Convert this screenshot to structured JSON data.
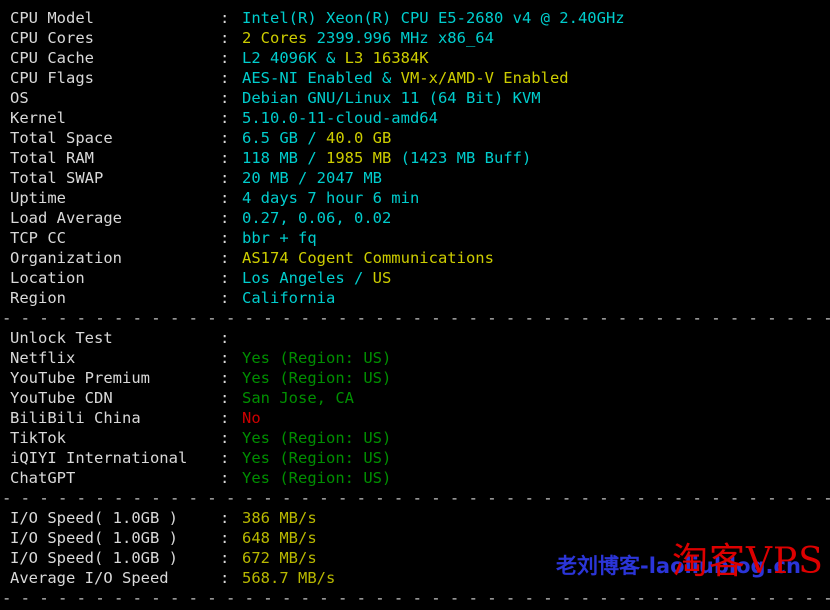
{
  "terminal": {
    "separator": "- - - - - - - - - - - - - - - - - - - - - - - - - - - - - - - - - - - - - - - - - - - - - - - - - - - - - - - - - - - - - - - - - - - -",
    "colon": ":"
  },
  "sections": {
    "system": {
      "rows": [
        {
          "label": "CPU Model",
          "parts": [
            {
              "text": "Intel(R) Xeon(R) CPU E5-2680 v4 @ 2.40GHz",
              "color": "cyan"
            }
          ]
        },
        {
          "label": "CPU Cores",
          "parts": [
            {
              "text": "2 Cores ",
              "color": "yellow"
            },
            {
              "text": "2399.996 MHz x86_64",
              "color": "cyan"
            }
          ]
        },
        {
          "label": "CPU Cache",
          "parts": [
            {
              "text": "L2 4096K & ",
              "color": "cyan"
            },
            {
              "text": "L3 16384K",
              "color": "yellow"
            }
          ]
        },
        {
          "label": "CPU Flags",
          "parts": [
            {
              "text": "AES-NI Enabled & ",
              "color": "cyan"
            },
            {
              "text": "VM-x/AMD-V Enabled",
              "color": "yellow"
            }
          ]
        },
        {
          "label": "OS",
          "parts": [
            {
              "text": "Debian GNU/Linux 11 (64 Bit) KVM",
              "color": "cyan"
            }
          ]
        },
        {
          "label": "Kernel",
          "parts": [
            {
              "text": "5.10.0-11-cloud-amd64",
              "color": "cyan"
            }
          ]
        },
        {
          "label": "Total Space",
          "parts": [
            {
              "text": "6.5 GB / ",
              "color": "cyan"
            },
            {
              "text": "40.0 GB",
              "color": "yellow"
            }
          ]
        },
        {
          "label": "Total RAM",
          "parts": [
            {
              "text": "118 MB / ",
              "color": "cyan"
            },
            {
              "text": "1985 MB ",
              "color": "yellow"
            },
            {
              "text": "(1423 MB Buff)",
              "color": "cyan"
            }
          ]
        },
        {
          "label": "Total SWAP",
          "parts": [
            {
              "text": "20 MB / 2047 MB",
              "color": "cyan"
            }
          ]
        },
        {
          "label": "Uptime",
          "parts": [
            {
              "text": "4 days 7 hour 6 min",
              "color": "cyan"
            }
          ]
        },
        {
          "label": "Load Average",
          "parts": [
            {
              "text": "0.27, 0.06, 0.02",
              "color": "cyan"
            }
          ]
        },
        {
          "label": "TCP CC",
          "parts": [
            {
              "text": "bbr + fq",
              "color": "cyan"
            }
          ]
        },
        {
          "label": "Organization",
          "parts": [
            {
              "text": "AS174 Cogent Communications",
              "color": "yellow"
            }
          ]
        },
        {
          "label": "Location",
          "parts": [
            {
              "text": "Los Angeles / ",
              "color": "cyan"
            },
            {
              "text": "US",
              "color": "yellow"
            }
          ]
        },
        {
          "label": "Region",
          "parts": [
            {
              "text": "California",
              "color": "cyan"
            }
          ]
        }
      ]
    },
    "unlock": {
      "rows": [
        {
          "label": "Unlock Test",
          "parts": [
            {
              "text": "",
              "color": "white"
            }
          ]
        },
        {
          "label": "Netflix",
          "parts": [
            {
              "text": "Yes (Region: US)",
              "color": "green"
            }
          ]
        },
        {
          "label": "YouTube Premium",
          "parts": [
            {
              "text": "Yes (Region: US)",
              "color": "green"
            }
          ]
        },
        {
          "label": "YouTube CDN",
          "parts": [
            {
              "text": "San Jose, CA",
              "color": "green"
            }
          ]
        },
        {
          "label": "BiliBili China",
          "parts": [
            {
              "text": "No",
              "color": "red"
            }
          ]
        },
        {
          "label": "TikTok",
          "parts": [
            {
              "text": "Yes (Region: US)",
              "color": "green"
            }
          ]
        },
        {
          "label": "iQIYI International",
          "parts": [
            {
              "text": "Yes (Region: US)",
              "color": "green"
            }
          ]
        },
        {
          "label": "ChatGPT",
          "parts": [
            {
              "text": "Yes (Region: US)",
              "color": "green"
            }
          ]
        }
      ]
    },
    "io": {
      "rows": [
        {
          "label": "I/O Speed( 1.0GB )",
          "parts": [
            {
              "text": "386 MB/s",
              "color": "olive"
            }
          ]
        },
        {
          "label": "I/O Speed( 1.0GB )",
          "parts": [
            {
              "text": "648 MB/s",
              "color": "olive"
            }
          ]
        },
        {
          "label": "I/O Speed( 1.0GB )",
          "parts": [
            {
              "text": "672 MB/s",
              "color": "olive"
            }
          ]
        },
        {
          "label": "Average I/O Speed",
          "parts": [
            {
              "text": "568.7 MB/s",
              "color": "olive"
            }
          ]
        }
      ]
    }
  },
  "watermarks": {
    "blue": {
      "text": "老刘博客-laoliublog.cn",
      "color": "#2b35d8"
    },
    "red": {
      "text": "淘客VPS",
      "color": "#dd0000"
    }
  }
}
